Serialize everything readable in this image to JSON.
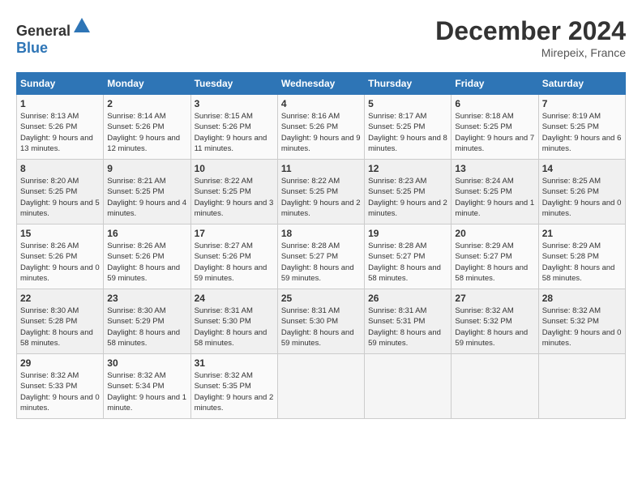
{
  "header": {
    "logo_general": "General",
    "logo_blue": "Blue",
    "month": "December 2024",
    "location": "Mirepeix, France"
  },
  "days_of_week": [
    "Sunday",
    "Monday",
    "Tuesday",
    "Wednesday",
    "Thursday",
    "Friday",
    "Saturday"
  ],
  "weeks": [
    [
      {
        "day": "1",
        "sunrise": "8:13 AM",
        "sunset": "5:26 PM",
        "daylight": "9 hours and 13 minutes."
      },
      {
        "day": "2",
        "sunrise": "8:14 AM",
        "sunset": "5:26 PM",
        "daylight": "9 hours and 12 minutes."
      },
      {
        "day": "3",
        "sunrise": "8:15 AM",
        "sunset": "5:26 PM",
        "daylight": "9 hours and 11 minutes."
      },
      {
        "day": "4",
        "sunrise": "8:16 AM",
        "sunset": "5:26 PM",
        "daylight": "9 hours and 9 minutes."
      },
      {
        "day": "5",
        "sunrise": "8:17 AM",
        "sunset": "5:25 PM",
        "daylight": "9 hours and 8 minutes."
      },
      {
        "day": "6",
        "sunrise": "8:18 AM",
        "sunset": "5:25 PM",
        "daylight": "9 hours and 7 minutes."
      },
      {
        "day": "7",
        "sunrise": "8:19 AM",
        "sunset": "5:25 PM",
        "daylight": "9 hours and 6 minutes."
      }
    ],
    [
      {
        "day": "8",
        "sunrise": "8:20 AM",
        "sunset": "5:25 PM",
        "daylight": "9 hours and 5 minutes."
      },
      {
        "day": "9",
        "sunrise": "8:21 AM",
        "sunset": "5:25 PM",
        "daylight": "9 hours and 4 minutes."
      },
      {
        "day": "10",
        "sunrise": "8:22 AM",
        "sunset": "5:25 PM",
        "daylight": "9 hours and 3 minutes."
      },
      {
        "day": "11",
        "sunrise": "8:22 AM",
        "sunset": "5:25 PM",
        "daylight": "9 hours and 2 minutes."
      },
      {
        "day": "12",
        "sunrise": "8:23 AM",
        "sunset": "5:25 PM",
        "daylight": "9 hours and 2 minutes."
      },
      {
        "day": "13",
        "sunrise": "8:24 AM",
        "sunset": "5:25 PM",
        "daylight": "9 hours and 1 minute."
      },
      {
        "day": "14",
        "sunrise": "8:25 AM",
        "sunset": "5:26 PM",
        "daylight": "9 hours and 0 minutes."
      }
    ],
    [
      {
        "day": "15",
        "sunrise": "8:26 AM",
        "sunset": "5:26 PM",
        "daylight": "9 hours and 0 minutes."
      },
      {
        "day": "16",
        "sunrise": "8:26 AM",
        "sunset": "5:26 PM",
        "daylight": "8 hours and 59 minutes."
      },
      {
        "day": "17",
        "sunrise": "8:27 AM",
        "sunset": "5:26 PM",
        "daylight": "8 hours and 59 minutes."
      },
      {
        "day": "18",
        "sunrise": "8:28 AM",
        "sunset": "5:27 PM",
        "daylight": "8 hours and 59 minutes."
      },
      {
        "day": "19",
        "sunrise": "8:28 AM",
        "sunset": "5:27 PM",
        "daylight": "8 hours and 58 minutes."
      },
      {
        "day": "20",
        "sunrise": "8:29 AM",
        "sunset": "5:27 PM",
        "daylight": "8 hours and 58 minutes."
      },
      {
        "day": "21",
        "sunrise": "8:29 AM",
        "sunset": "5:28 PM",
        "daylight": "8 hours and 58 minutes."
      }
    ],
    [
      {
        "day": "22",
        "sunrise": "8:30 AM",
        "sunset": "5:28 PM",
        "daylight": "8 hours and 58 minutes."
      },
      {
        "day": "23",
        "sunrise": "8:30 AM",
        "sunset": "5:29 PM",
        "daylight": "8 hours and 58 minutes."
      },
      {
        "day": "24",
        "sunrise": "8:31 AM",
        "sunset": "5:30 PM",
        "daylight": "8 hours and 58 minutes."
      },
      {
        "day": "25",
        "sunrise": "8:31 AM",
        "sunset": "5:30 PM",
        "daylight": "8 hours and 59 minutes."
      },
      {
        "day": "26",
        "sunrise": "8:31 AM",
        "sunset": "5:31 PM",
        "daylight": "8 hours and 59 minutes."
      },
      {
        "day": "27",
        "sunrise": "8:32 AM",
        "sunset": "5:32 PM",
        "daylight": "8 hours and 59 minutes."
      },
      {
        "day": "28",
        "sunrise": "8:32 AM",
        "sunset": "5:32 PM",
        "daylight": "9 hours and 0 minutes."
      }
    ],
    [
      {
        "day": "29",
        "sunrise": "8:32 AM",
        "sunset": "5:33 PM",
        "daylight": "9 hours and 0 minutes."
      },
      {
        "day": "30",
        "sunrise": "8:32 AM",
        "sunset": "5:34 PM",
        "daylight": "9 hours and 1 minute."
      },
      {
        "day": "31",
        "sunrise": "8:32 AM",
        "sunset": "5:35 PM",
        "daylight": "9 hours and 2 minutes."
      },
      null,
      null,
      null,
      null
    ]
  ],
  "labels": {
    "sunrise": "Sunrise:",
    "sunset": "Sunset:",
    "daylight": "Daylight:"
  }
}
